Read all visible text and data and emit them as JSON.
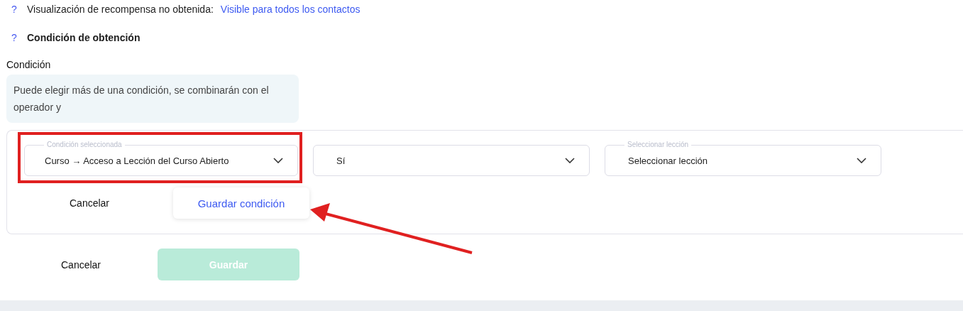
{
  "reward_visibility": {
    "help": "?",
    "label": "Visualización de recompensa no obtenida:",
    "value": "Visible para todos los contactos"
  },
  "obtain_condition": {
    "help": "?",
    "title": "Condición de obtención"
  },
  "condition": {
    "label": "Condición",
    "info": "Puede elegir más de una condición, se combinarán con el operador y",
    "selects": [
      {
        "label": "Condición seleccionada",
        "value": "Curso → Acceso a Lección del Curso Abierto",
        "highlighted": true
      },
      {
        "value": "Sí",
        "highlighted": false
      },
      {
        "label": "Seleccionar lección",
        "value": "Seleccionar lección",
        "highlighted": false
      }
    ],
    "cancel": "Cancelar",
    "save_condition": "Guardar condición"
  },
  "footer": {
    "cancel": "Cancelar",
    "save": {
      "label": "Guardar",
      "disabled": true
    }
  }
}
